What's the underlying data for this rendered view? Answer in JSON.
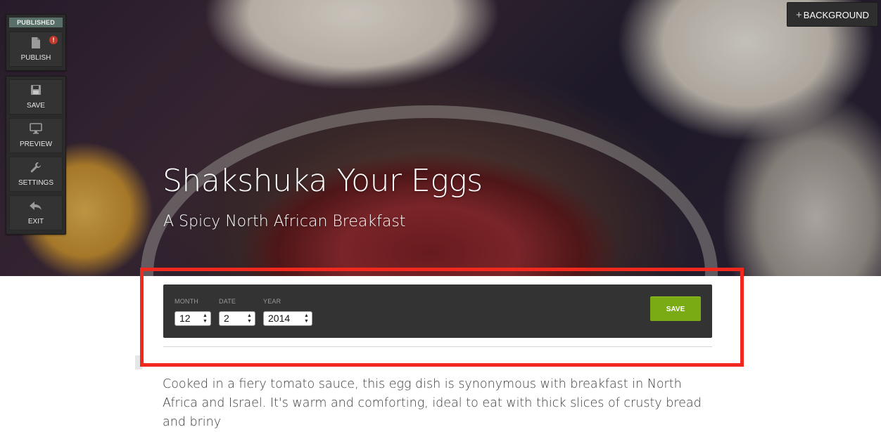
{
  "toolbar": {
    "status": "PUBLISHED",
    "publish_label": "PUBLISH",
    "publish_alert": "!",
    "save_label": "SAVE",
    "preview_label": "PREVIEW",
    "settings_label": "SETTINGS",
    "exit_label": "EXIT"
  },
  "background_button": {
    "icon": "plus-icon",
    "label": "BACKGROUND"
  },
  "hero": {
    "title": "Shakshuka Your Eggs",
    "subtitle": "A Spicy North African Breakfast"
  },
  "date_editor": {
    "month_label": "MONTH",
    "month_value": "12",
    "date_label": "DATE",
    "date_value": "2",
    "year_label": "YEAR",
    "year_value": "2014",
    "save_label": "SAVE"
  },
  "article": {
    "body": "Cooked in a fiery tomato sauce, this egg dish is synonymous with breakfast in North Africa and Israel. It's warm and comforting, ideal to eat with thick slices of crusty bread and briny"
  },
  "colors": {
    "highlight": "#f0281e",
    "save_button": "#7bab14",
    "panel": "#333333"
  }
}
